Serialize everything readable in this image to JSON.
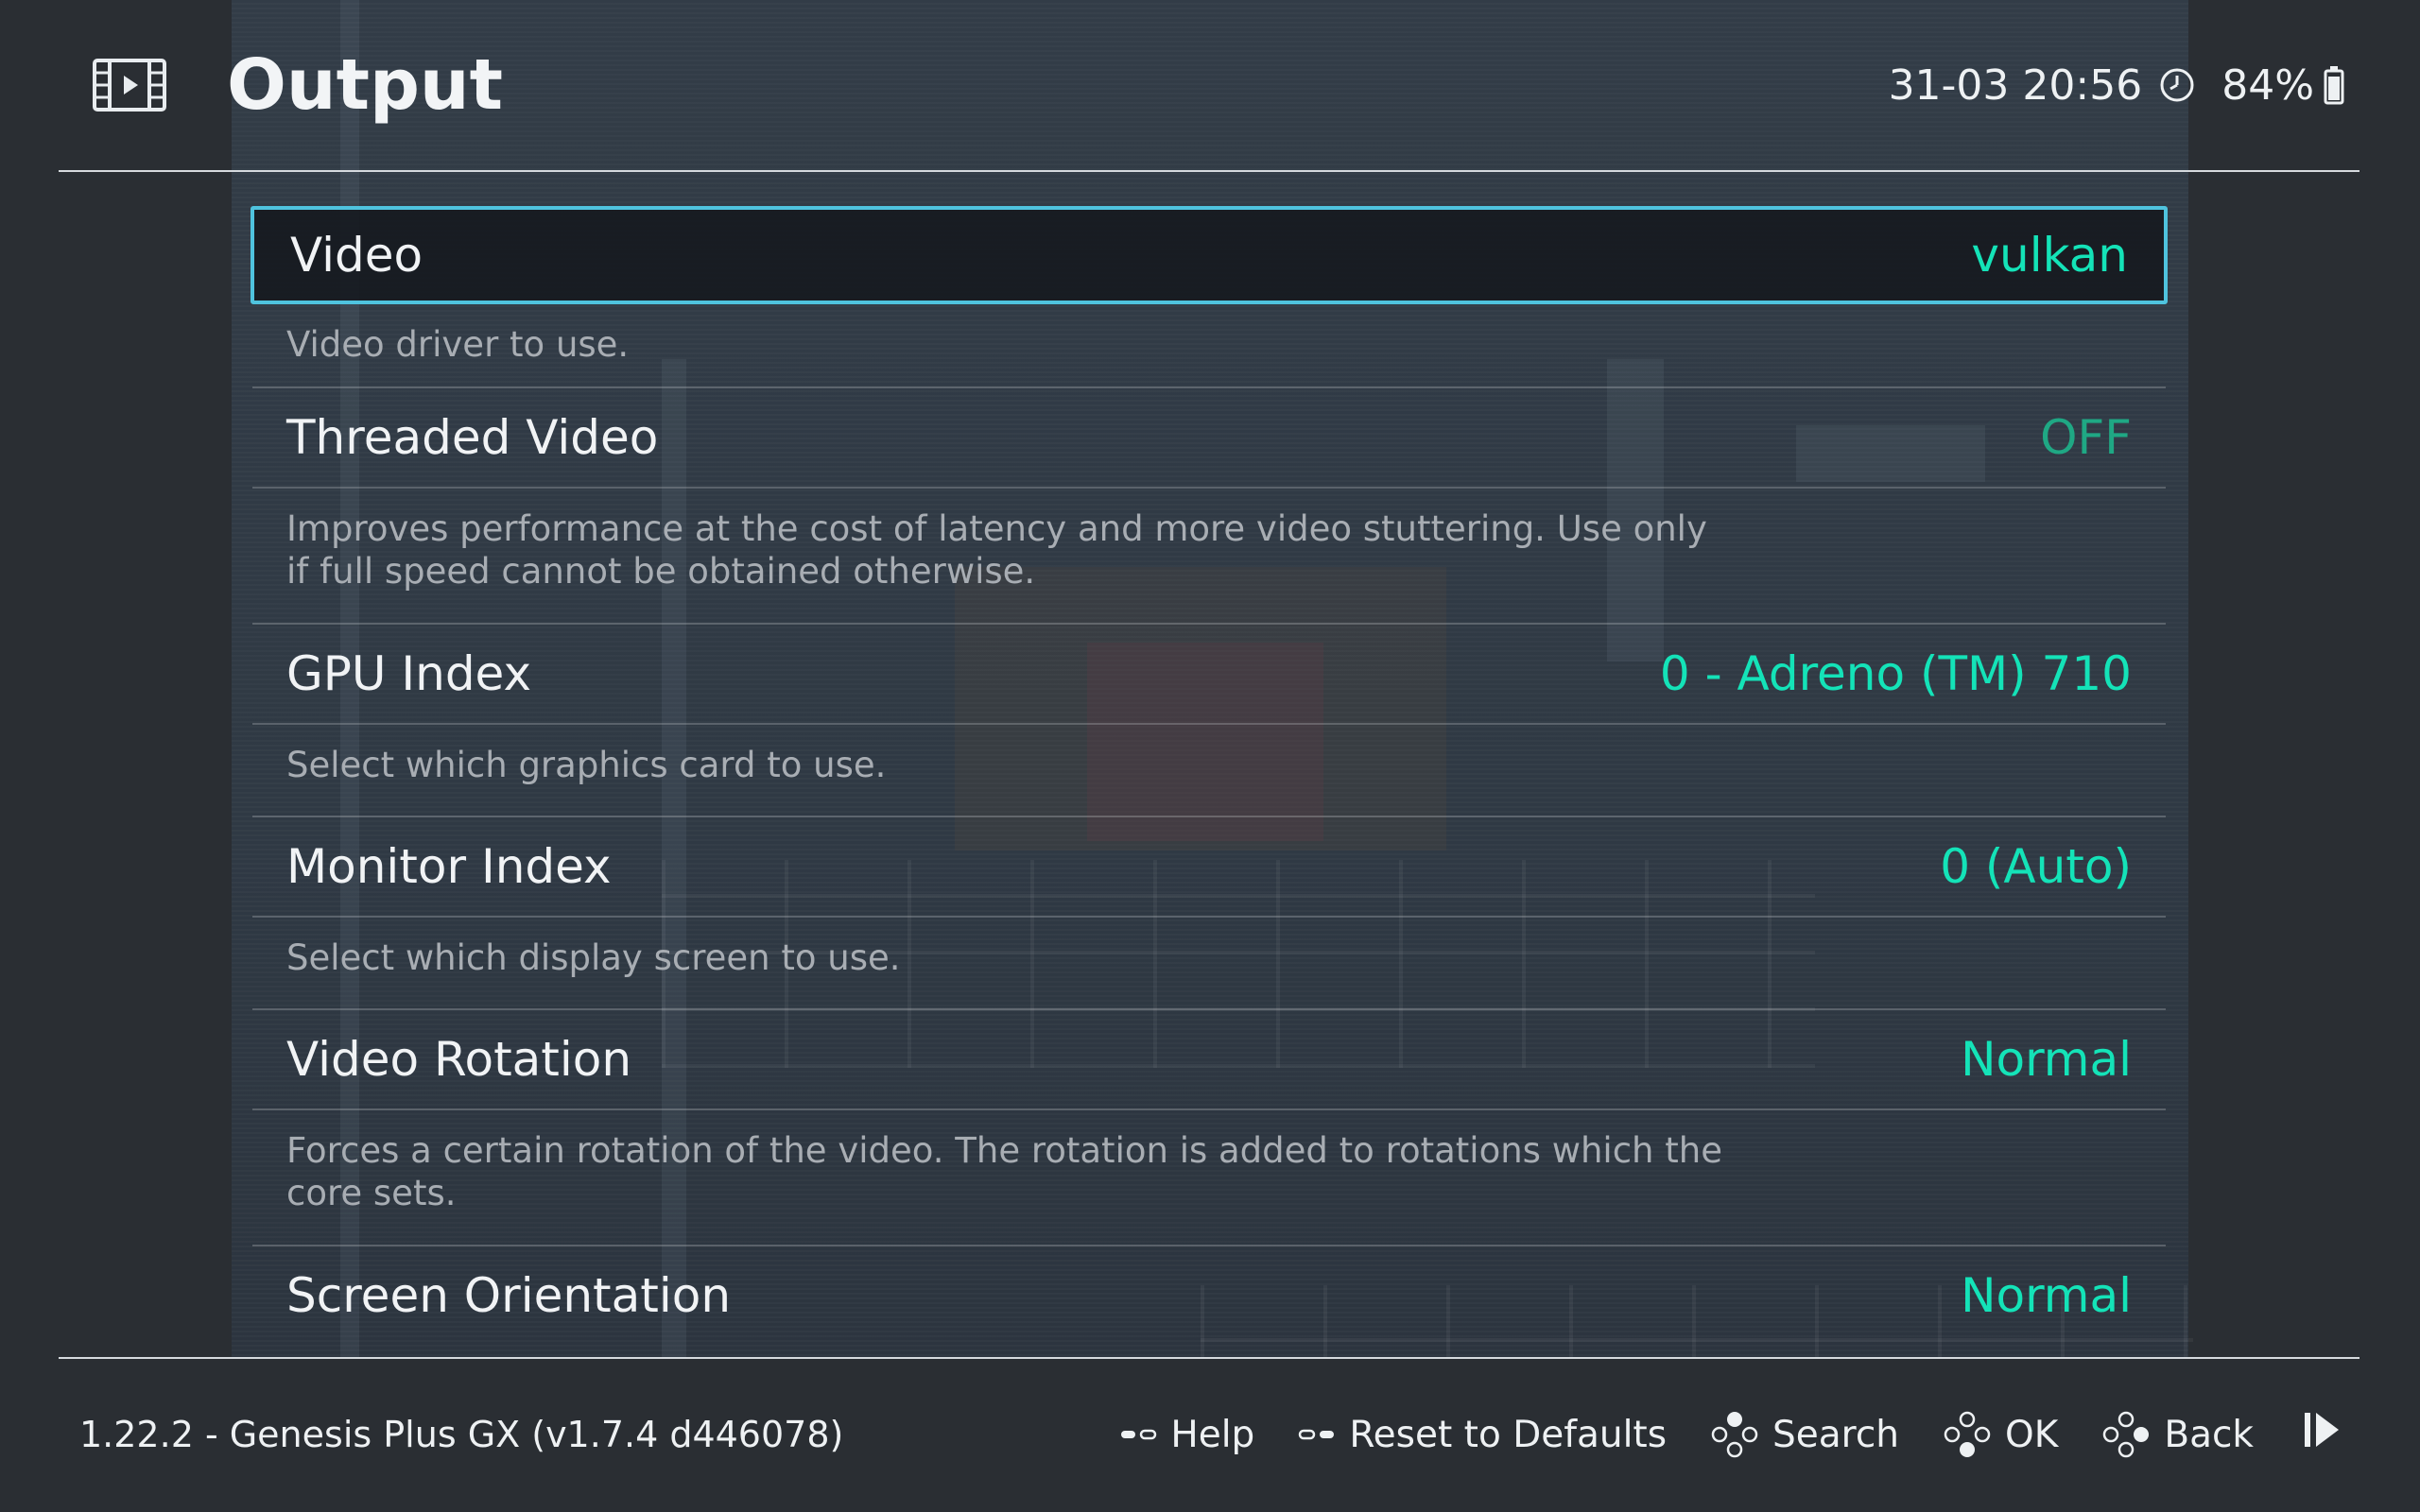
{
  "header": {
    "title": "Output",
    "icon": "film-icon",
    "datetime": "31-03 20:56",
    "clock_icon": "clock-icon",
    "battery": "84%",
    "battery_icon": "battery-icon"
  },
  "settings": [
    {
      "label": "Video",
      "value": "vulkan",
      "description": "Video driver to use.",
      "selected": true
    },
    {
      "label": "Threaded Video",
      "value": "OFF",
      "description": "Improves performance at the cost of latency and more video stuttering. Use only if full speed cannot be obtained otherwise."
    },
    {
      "label": "GPU Index",
      "value": "0 - Adreno (TM) 710",
      "description": "Select which graphics card to use."
    },
    {
      "label": "Monitor Index",
      "value": "0 (Auto)",
      "description": "Select which display screen to use."
    },
    {
      "label": "Video Rotation",
      "value": "Normal",
      "description": "Forces a certain rotation of the video. The rotation is added to rotations which the core sets."
    },
    {
      "label": "Screen Orientation",
      "value": "Normal"
    }
  ],
  "footer": {
    "version": "1.22.2 - Genesis Plus GX (v1.7.4 d446078)",
    "actions": {
      "help": "Help",
      "reset": "Reset to Defaults",
      "search": "Search",
      "ok": "OK",
      "back": "Back"
    }
  },
  "colors": {
    "accent_border": "#4fc3de",
    "value_text": "#14e3b8",
    "value_off": "#1fa884"
  }
}
